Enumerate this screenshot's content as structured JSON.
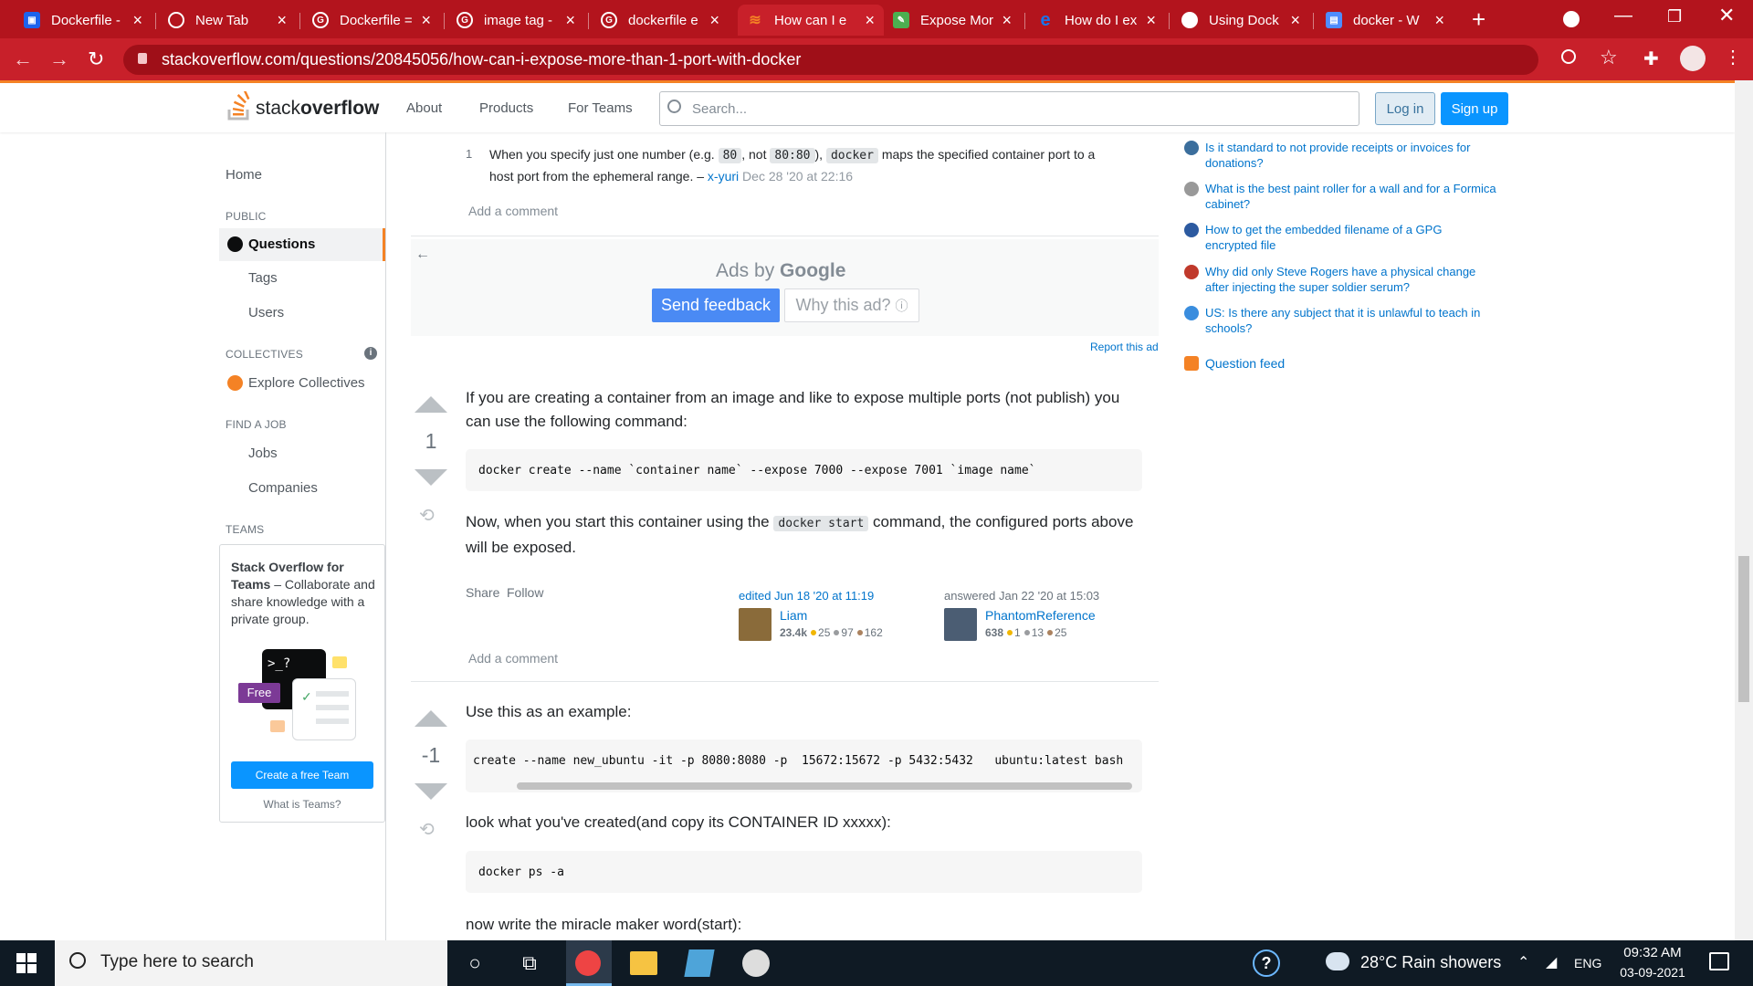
{
  "browser": {
    "tabs": [
      {
        "title": "Dockerfile -",
        "icon": "docker-icon",
        "color": "#1d63ed"
      },
      {
        "title": "New Tab",
        "icon": "chrome-icon",
        "color": "#ffffff"
      },
      {
        "title": "Dockerfile =",
        "icon": "google-icon",
        "color": "#ffffff"
      },
      {
        "title": "image tag -",
        "icon": "google-icon",
        "color": "#ffffff"
      },
      {
        "title": "dockerfile e",
        "icon": "google-icon",
        "color": "#ffffff"
      },
      {
        "title": "How can I e",
        "icon": "stackoverflow-icon",
        "color": "#f48225"
      },
      {
        "title": "Expose Mor",
        "icon": "leaf-icon",
        "color": "#4caf50"
      },
      {
        "title": "How do I ex",
        "icon": "ie-icon",
        "color": "#1a73e8"
      },
      {
        "title": "Using Dock",
        "icon": "globe-icon",
        "color": "#ffffff"
      },
      {
        "title": "docker - W",
        "icon": "app-icon",
        "color": "#4e8cff"
      }
    ],
    "new_tab": "+",
    "url": "stackoverflow.com/questions/20845056/how-can-i-expose-more-than-1-port-with-docker"
  },
  "so_header": {
    "logo_a": "stack",
    "logo_b": "overflow",
    "nav": [
      "About",
      "Products",
      "For Teams"
    ],
    "search_placeholder": "Search...",
    "login": "Log in",
    "signup": "Sign up"
  },
  "left_nav": {
    "home": "Home",
    "public": "PUBLIC",
    "questions": "Questions",
    "tags": "Tags",
    "users": "Users",
    "collectives": "COLLECTIVES",
    "explore": "Explore Collectives",
    "find_job": "FIND A JOB",
    "jobs": "Jobs",
    "companies": "Companies",
    "teams": "TEAMS",
    "teams_title": "Stack Overflow for Teams",
    "teams_desc": "– Collaborate and share knowledge with a private group.",
    "free_badge": "Free",
    "terminal": ">_?",
    "create_team": "Create a free Team",
    "what_is": "What is Teams?"
  },
  "comment": {
    "score": "1",
    "text_a": "When you specify just one number (e.g.",
    "code_a": "80",
    "text_b": ", not",
    "code_b": "80:80",
    "text_c": "),",
    "code_c": "docker",
    "text_d": "maps the specified container port to a",
    "text_e": "host port from the ephemeral range. –",
    "user": "x-yuri",
    "date": "Dec 28 '20 at 22:16",
    "add": "Add a comment"
  },
  "ad": {
    "ads_by": "Ads by",
    "google": "Google",
    "send_feedback": "Send feedback",
    "why": "Why this ad?",
    "report": "Report this ad"
  },
  "answer1": {
    "votes": "1",
    "p1": "If you are creating a container from an image and like to expose multiple ports (not publish) you can use the following command:",
    "code": "docker create --name `container name` --expose 7000 --expose 7001 `image name`",
    "p2a": "Now, when you start this container using the",
    "p2code": "docker start",
    "p2b": "command, the configured ports above will be exposed.",
    "share": "Share",
    "follow": "Follow",
    "edited": "edited Jun 18 '20 at 11:19",
    "editor": "Liam",
    "editor_rep": "23.4k",
    "editor_gold": "25",
    "editor_silver": "97",
    "editor_bronze": "162",
    "answered": "answered Jan 22 '20 at 15:03",
    "author": "PhantomReference",
    "author_rep": "638",
    "author_gold": "1",
    "author_silver": "13",
    "author_bronze": "25",
    "add": "Add a comment"
  },
  "answer2": {
    "votes": "-1",
    "p1": "Use this as an example:",
    "code1": "create --name new_ubuntu -it -p 8080:8080 -p  15672:15672 -p 5432:5432   ubuntu:latest bash",
    "p2": "look what you've created(and copy its CONTAINER ID xxxxx):",
    "code2": "docker ps -a",
    "p3": "now write the miracle maker word(start):"
  },
  "hot_questions": [
    {
      "text": "Is it standard to not provide receipts or invoices for donations?",
      "color": "#3b6e9c"
    },
    {
      "text": "What is the best paint roller for a wall and for a Formica cabinet?",
      "color": "#999999"
    },
    {
      "text": "How to get the embedded filename of a GPG encrypted file",
      "color": "#2c5aa0"
    },
    {
      "text": "Why did only Steve Rogers have a physical change after injecting the super soldier serum?",
      "color": "#c0392b"
    },
    {
      "text": "US: Is there any subject that it is unlawful to teach in schools?",
      "color": "#3a8dde"
    }
  ],
  "question_feed": "Question feed",
  "taskbar": {
    "search": "Type here to search",
    "weather": "28°C  Rain showers",
    "lang": "ENG",
    "time": "09:32 AM",
    "date": "03-09-2021"
  }
}
